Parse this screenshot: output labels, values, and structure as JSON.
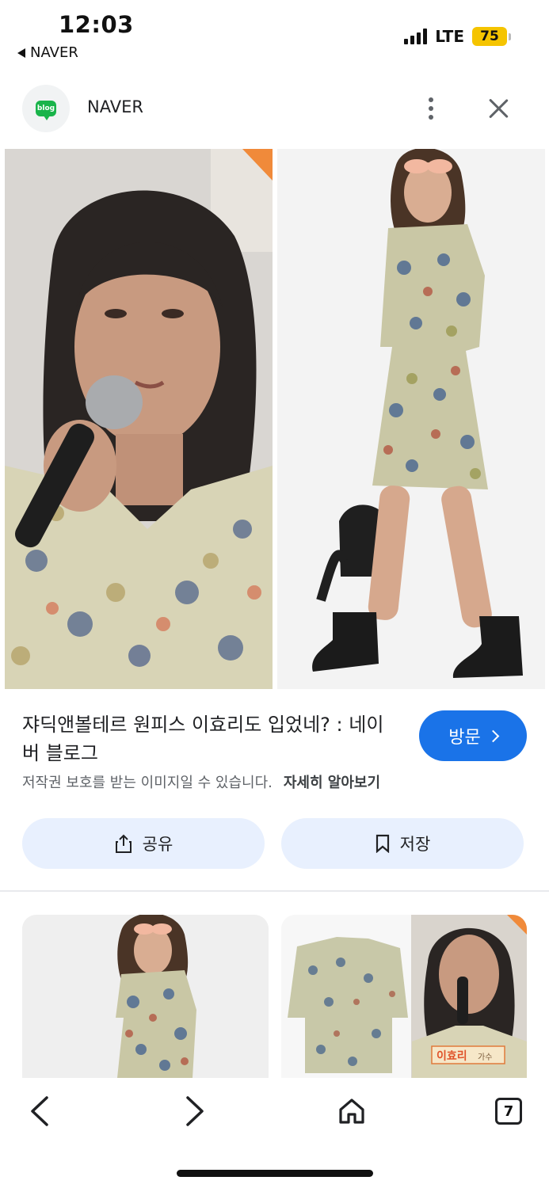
{
  "status_bar": {
    "time": "12:03",
    "back_app": "NAVER",
    "network": "LTE",
    "battery": "75"
  },
  "header": {
    "logo_text": "blog",
    "site_name": "NAVER"
  },
  "result": {
    "title": "쟈딕앤볼테르 원피스 이효리도 입었네? : 네이버 블로그",
    "visit_label": "방문",
    "copyright_notice": "저작권 보호를 받는 이미지일 수 있습니다.",
    "learn_more": "자세히 알아보기",
    "share_label": "공유",
    "save_label": "저장"
  },
  "related": {
    "tag_name": "이효리",
    "tag_role": "가수"
  },
  "bottom_nav": {
    "tab_count": "7"
  },
  "icons": {
    "back": "chevron-left-icon",
    "forward": "chevron-right-icon",
    "home": "home-icon",
    "tabs": "tabs-icon",
    "share": "share-icon",
    "save": "bookmark-icon",
    "more": "more-vert-icon",
    "close": "close-icon"
  },
  "colors": {
    "accent": "#1a73e8",
    "chip_bg": "#e8f0fe",
    "battery": "#f5c400",
    "blog_green": "#19b44a"
  }
}
